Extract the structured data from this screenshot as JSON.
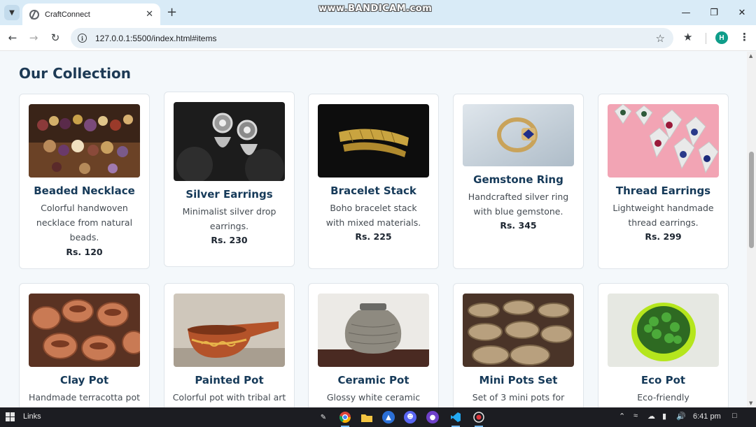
{
  "browser": {
    "tab_title": "CraftConnect",
    "url": "127.0.0.1:5500/index.html#items",
    "profile_initial": "H",
    "watermark": "www.BANDICAM.com"
  },
  "page": {
    "section_title": "Our Collection",
    "products": [
      {
        "name": "Beaded Necklace",
        "description": "Colorful handwoven necklace from natural beads.",
        "price": "Rs. 120",
        "image": "beaded-necklace"
      },
      {
        "name": "Silver Earrings",
        "description": "Minimalist silver drop earrings.",
        "price": "Rs. 230",
        "image": "silver-earrings"
      },
      {
        "name": "Bracelet Stack",
        "description": "Boho bracelet stack with mixed materials.",
        "price": "Rs. 225",
        "image": "gold-bracelet"
      },
      {
        "name": "Gemstone Ring",
        "description": "Handcrafted silver ring with blue gemstone.",
        "price": "Rs. 345",
        "image": "gemstone-ring"
      },
      {
        "name": "Thread Earrings",
        "description": "Lightweight handmade thread earrings.",
        "price": "Rs. 299",
        "image": "thread-earrings"
      },
      {
        "name": "Clay Pot",
        "description": "Handmade terracotta pot",
        "image": "clay-pots"
      },
      {
        "name": "Painted Pot",
        "description": "Colorful pot with tribal art",
        "image": "painted-pot"
      },
      {
        "name": "Ceramic Pot",
        "description": "Glossy white ceramic",
        "image": "ceramic-pot"
      },
      {
        "name": "Mini Pots Set",
        "description": "Set of 3 mini pots for",
        "image": "mini-pots"
      },
      {
        "name": "Eco Pot",
        "description": "Eco-friendly",
        "image": "eco-pot"
      }
    ]
  },
  "taskbar": {
    "links_label": "Links",
    "time": "6:41 pm"
  },
  "colors": {
    "heading": "#1d3a55",
    "card_border": "#dfe5ea",
    "page_background": "#f4f8fb",
    "tabbar": "#d9ebf7"
  }
}
